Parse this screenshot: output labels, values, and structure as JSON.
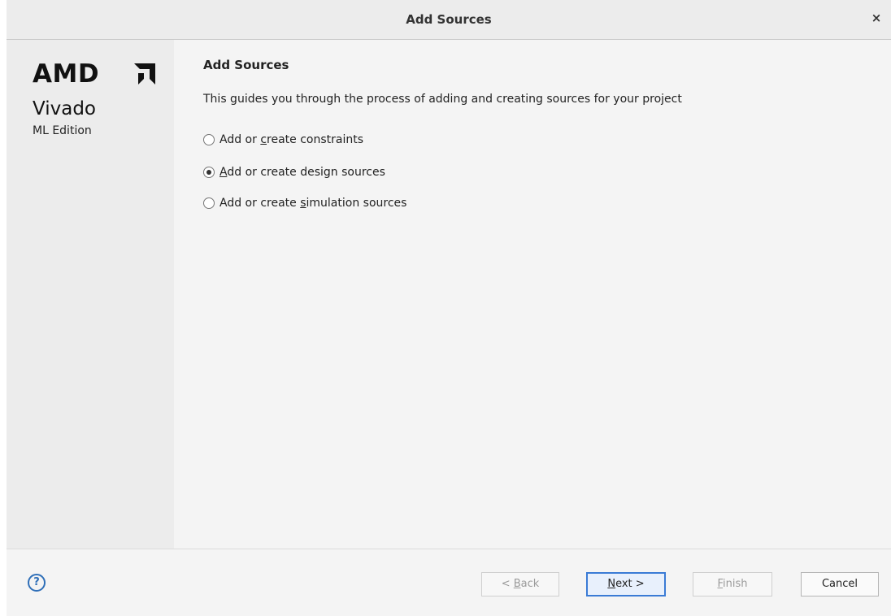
{
  "window": {
    "title": "Add Sources",
    "close_symbol": "×"
  },
  "sidebar": {
    "brand": "AMD",
    "brand_mark_icon": "amd-arrow-logo",
    "product": "Vivado",
    "edition": "ML Edition"
  },
  "main": {
    "heading": "Add Sources",
    "description": "This guides you through the process of adding and creating sources for your project",
    "options": [
      {
        "label_pre": "Add or ",
        "mnemonic": "c",
        "label_post": "reate constraints",
        "checked": false
      },
      {
        "label_pre": "",
        "mnemonic": "A",
        "label_post": "dd or create design sources",
        "checked": true
      },
      {
        "label_pre": "Add or create ",
        "mnemonic": "s",
        "label_post": "imulation sources",
        "checked": false
      }
    ]
  },
  "footer": {
    "help_symbol": "?",
    "back": {
      "pre": "< ",
      "mnemonic": "B",
      "post": "ack",
      "enabled": false
    },
    "next": {
      "pre": "",
      "mnemonic": "N",
      "post": "ext >",
      "enabled": true
    },
    "finish": {
      "pre": "",
      "mnemonic": "F",
      "post": "inish",
      "enabled": false
    },
    "cancel": {
      "label": "Cancel",
      "enabled": true
    }
  },
  "colors": {
    "accent": "#3a7bd5",
    "help_icon": "#2f6fb8"
  }
}
